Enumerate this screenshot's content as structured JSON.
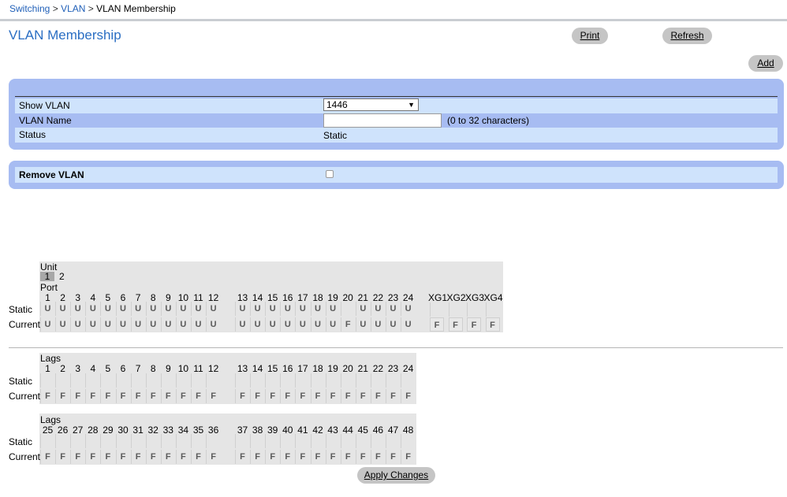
{
  "breadcrumb": {
    "switching": "Switching",
    "vlan": "VLAN",
    "current": "VLAN Membership",
    "sep": ">"
  },
  "title": "VLAN Membership",
  "buttons": {
    "print": "Print",
    "refresh": "Refresh",
    "add": "Add",
    "apply": "Apply Changes"
  },
  "form": {
    "show_vlan_label": "Show VLAN",
    "show_vlan_value": "1446",
    "vlan_name_label": "VLAN Name",
    "vlan_name_value": "",
    "vlan_name_hint": "(0 to 32 characters)",
    "status_label": "Status",
    "status_value": "Static",
    "remove_label": "Remove VLAN"
  },
  "ports_section": {
    "unit_label": "Unit",
    "units": [
      "1",
      "2"
    ],
    "selected_unit": "1",
    "port_label": "Port",
    "static_label": "Static",
    "current_label": "Current",
    "ports_a": [
      "1",
      "2",
      "3",
      "4",
      "5",
      "6",
      "7",
      "8",
      "9",
      "10",
      "11",
      "12"
    ],
    "ports_b": [
      "13",
      "14",
      "15",
      "16",
      "17",
      "18",
      "19",
      "20",
      "21",
      "22",
      "23",
      "24"
    ],
    "static_a": [
      "U",
      "U",
      "U",
      "U",
      "U",
      "U",
      "U",
      "U",
      "U",
      "U",
      "U",
      "U"
    ],
    "static_b": [
      "U",
      "U",
      "U",
      "U",
      "U",
      "U",
      "U",
      "",
      "U",
      "U",
      "U",
      "U"
    ],
    "current_a": [
      "U",
      "U",
      "U",
      "U",
      "U",
      "U",
      "U",
      "U",
      "U",
      "U",
      "U",
      "U"
    ],
    "current_b": [
      "U",
      "U",
      "U",
      "U",
      "U",
      "U",
      "U",
      "F",
      "U",
      "U",
      "U",
      "U"
    ],
    "xg_ports": [
      "XG1",
      "XG2",
      "XG3",
      "XG4"
    ],
    "xg_static": [
      "",
      "",
      "",
      ""
    ],
    "xg_current": [
      "F",
      "F",
      "F",
      "F"
    ]
  },
  "lags1": {
    "label": "Lags",
    "static_label": "Static",
    "current_label": "Current",
    "nums_a": [
      "1",
      "2",
      "3",
      "4",
      "5",
      "6",
      "7",
      "8",
      "9",
      "10",
      "11",
      "12"
    ],
    "nums_b": [
      "13",
      "14",
      "15",
      "16",
      "17",
      "18",
      "19",
      "20",
      "21",
      "22",
      "23",
      "24"
    ],
    "static_a": [
      "",
      "",
      "",
      "",
      "",
      "",
      "",
      "",
      "",
      "",
      "",
      ""
    ],
    "static_b": [
      "",
      "",
      "",
      "",
      "",
      "",
      "",
      "",
      "",
      "",
      "",
      ""
    ],
    "current_a": [
      "F",
      "F",
      "F",
      "F",
      "F",
      "F",
      "F",
      "F",
      "F",
      "F",
      "F",
      "F"
    ],
    "current_b": [
      "F",
      "F",
      "F",
      "F",
      "F",
      "F",
      "F",
      "F",
      "F",
      "F",
      "F",
      "F"
    ]
  },
  "lags2": {
    "label": "Lags",
    "static_label": "Static",
    "current_label": "Current",
    "nums_a": [
      "25",
      "26",
      "27",
      "28",
      "29",
      "30",
      "31",
      "32",
      "33",
      "34",
      "35",
      "36"
    ],
    "nums_b": [
      "37",
      "38",
      "39",
      "40",
      "41",
      "42",
      "43",
      "44",
      "45",
      "46",
      "47",
      "48"
    ],
    "static_a": [
      "",
      "",
      "",
      "",
      "",
      "",
      "",
      "",
      "",
      "",
      "",
      ""
    ],
    "static_b": [
      "",
      "",
      "",
      "",
      "",
      "",
      "",
      "",
      "",
      "",
      "",
      ""
    ],
    "current_a": [
      "F",
      "F",
      "F",
      "F",
      "F",
      "F",
      "F",
      "F",
      "F",
      "F",
      "F",
      "F"
    ],
    "current_b": [
      "F",
      "F",
      "F",
      "F",
      "F",
      "F",
      "F",
      "F",
      "F",
      "F",
      "F",
      "F"
    ]
  }
}
